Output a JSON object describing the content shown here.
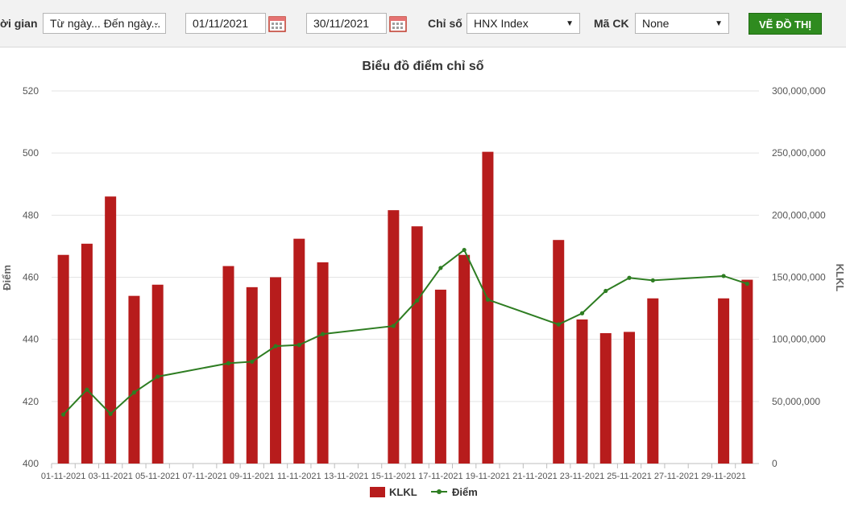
{
  "toolbar": {
    "time_label": "ời gian",
    "time_select": "Từ ngày... Đến ngày...",
    "from_date": "01/11/2021",
    "to_date": "30/11/2021",
    "index_label": "Chỉ số",
    "index_select": "HNX Index",
    "ck_label": "Mã CK",
    "ck_select": "None",
    "draw_button": "VẼ ĐỒ THỊ"
  },
  "colors": {
    "bar": "#b71c1c",
    "line": "#2e7d22",
    "button": "#2f8b1f"
  },
  "chart_data": {
    "type": "bar+line",
    "title": "Biểu đồ điểm chỉ số",
    "ylabel_left": "Điểm",
    "ylabel_right": "KLKL",
    "ylim_left": [
      400,
      520
    ],
    "yticks_left": [
      "400",
      "420",
      "440",
      "460",
      "480",
      "500",
      "520"
    ],
    "ylim_right": [
      0,
      300000000
    ],
    "yticks_right": [
      "0",
      "50,000,000",
      "100,000,000",
      "150,000,000",
      "200,000,000",
      "250,000,000",
      "300,000,000"
    ],
    "x_dates": [
      "01-11-2021",
      "02-11-2021",
      "03-11-2021",
      "04-11-2021",
      "05-11-2021",
      "06-11-2021",
      "07-11-2021",
      "08-11-2021",
      "09-11-2021",
      "10-11-2021",
      "11-11-2021",
      "12-11-2021",
      "13-11-2021",
      "14-11-2021",
      "15-11-2021",
      "16-11-2021",
      "17-11-2021",
      "18-11-2021",
      "19-11-2021",
      "20-11-2021",
      "21-11-2021",
      "22-11-2021",
      "23-11-2021",
      "24-11-2021",
      "25-11-2021",
      "26-11-2021",
      "27-11-2021",
      "28-11-2021",
      "29-11-2021",
      "30-11-2021"
    ],
    "x_tick_labels": [
      "01-11-2021",
      "03-11-2021",
      "05-11-2021",
      "07-11-2021",
      "09-11-2021",
      "11-11-2021",
      "13-11-2021",
      "15-11-2021",
      "17-11-2021",
      "19-11-2021",
      "21-11-2021",
      "23-11-2021",
      "25-11-2021",
      "27-11-2021",
      "29-11-2021"
    ],
    "series": [
      {
        "name": "KLKL",
        "kind": "bar",
        "points": [
          {
            "date": "01-11-2021",
            "value": 168000000
          },
          {
            "date": "02-11-2021",
            "value": 177000000
          },
          {
            "date": "03-11-2021",
            "value": 215000000
          },
          {
            "date": "04-11-2021",
            "value": 135000000
          },
          {
            "date": "05-11-2021",
            "value": 144000000
          },
          {
            "date": "08-11-2021",
            "value": 159000000
          },
          {
            "date": "09-11-2021",
            "value": 142000000
          },
          {
            "date": "10-11-2021",
            "value": 150000000
          },
          {
            "date": "11-11-2021",
            "value": 181000000
          },
          {
            "date": "12-11-2021",
            "value": 162000000
          },
          {
            "date": "15-11-2021",
            "value": 204000000
          },
          {
            "date": "16-11-2021",
            "value": 191000000
          },
          {
            "date": "17-11-2021",
            "value": 140000000
          },
          {
            "date": "18-11-2021",
            "value": 168000000
          },
          {
            "date": "19-11-2021",
            "value": 251000000
          },
          {
            "date": "22-11-2021",
            "value": 180000000
          },
          {
            "date": "23-11-2021",
            "value": 116000000
          },
          {
            "date": "24-11-2021",
            "value": 105000000
          },
          {
            "date": "25-11-2021",
            "value": 106000000
          },
          {
            "date": "26-11-2021",
            "value": 133000000
          },
          {
            "date": "29-11-2021",
            "value": 133000000
          },
          {
            "date": "30-11-2021",
            "value": 148000000
          }
        ]
      },
      {
        "name": "Điểm",
        "kind": "line",
        "points": [
          {
            "date": "01-11-2021",
            "value": 415.8
          },
          {
            "date": "02-11-2021",
            "value": 423.8
          },
          {
            "date": "03-11-2021",
            "value": 416.0
          },
          {
            "date": "04-11-2021",
            "value": 422.9
          },
          {
            "date": "05-11-2021",
            "value": 428.0
          },
          {
            "date": "08-11-2021",
            "value": 432.3
          },
          {
            "date": "09-11-2021",
            "value": 432.8
          },
          {
            "date": "10-11-2021",
            "value": 437.8
          },
          {
            "date": "11-11-2021",
            "value": 438.2
          },
          {
            "date": "12-11-2021",
            "value": 441.7
          },
          {
            "date": "15-11-2021",
            "value": 444.3
          },
          {
            "date": "16-11-2021",
            "value": 452.5
          },
          {
            "date": "17-11-2021",
            "value": 463.0
          },
          {
            "date": "18-11-2021",
            "value": 468.8
          },
          {
            "date": "19-11-2021",
            "value": 452.8
          },
          {
            "date": "22-11-2021",
            "value": 444.8
          },
          {
            "date": "23-11-2021",
            "value": 448.4
          },
          {
            "date": "24-11-2021",
            "value": 455.6
          },
          {
            "date": "25-11-2021",
            "value": 459.8
          },
          {
            "date": "26-11-2021",
            "value": 459.0
          },
          {
            "date": "29-11-2021",
            "value": 460.4
          },
          {
            "date": "30-11-2021",
            "value": 457.9
          }
        ]
      }
    ],
    "legend": [
      "KLKL",
      "Điểm"
    ],
    "legend_position": "bottom-center",
    "grid": true
  }
}
